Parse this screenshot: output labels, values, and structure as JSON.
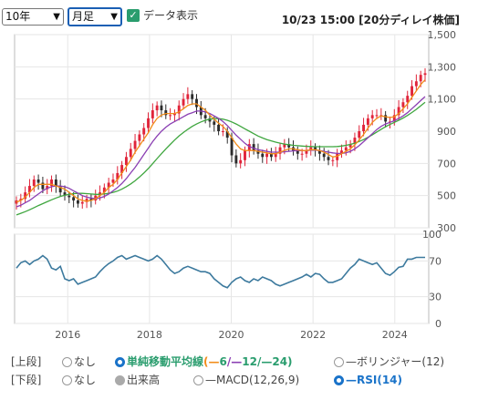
{
  "controls": {
    "period_value": "10年",
    "interval_value": "月足",
    "show_data_label": "データ表示",
    "timestamp": "10/23 15:00 [20分ディレイ株価]"
  },
  "legend": {
    "upper_label": "[上段]",
    "lower_label": "[下段]",
    "none1": "なし",
    "sma_label": "単純移動平均線",
    "sma6": "6",
    "sma12": "12",
    "sma24": "24",
    "bollinger": "ボリンジャー(12)",
    "none2": "なし",
    "volume": "出来高",
    "macd": "MACD(12,26,9)",
    "rsi": "RSI(14)"
  },
  "chart_data": [
    {
      "type": "candlestick",
      "x_ticks": [
        "2016",
        "2018",
        "2020",
        "2022",
        "2024"
      ],
      "y_ticks": [
        "300",
        "500",
        "700",
        "900",
        "1,100",
        "1,300",
        "1,500"
      ],
      "ylim": [
        300,
        1500
      ],
      "x_start_year": 2014.7,
      "x_end_year": 2024.83,
      "colors": {
        "up": "#e0243a",
        "down": "#2c2c2c",
        "sma6": "#f28c1a",
        "sma12": "#8b3fb3",
        "sma24": "#3fa63f"
      },
      "close": [
        470,
        480,
        520,
        560,
        600,
        580,
        540,
        560,
        600,
        560,
        520,
        500,
        490,
        470,
        450,
        460,
        480,
        470,
        500,
        520,
        550,
        580,
        600,
        640,
        690,
        740,
        790,
        840,
        880,
        920,
        980,
        1030,
        1060,
        1030,
        1000,
        1000,
        1010,
        1060,
        1100,
        1130,
        1100,
        1050,
        1000,
        980,
        960,
        940,
        900,
        900,
        860,
        750,
        700,
        720,
        780,
        820,
        780,
        760,
        740,
        760,
        740,
        760,
        800,
        820,
        800,
        780,
        760,
        760,
        780,
        800,
        780,
        760,
        740,
        720,
        720,
        760,
        780,
        800,
        820,
        860,
        900,
        940,
        980,
        1000,
        1000,
        1000,
        960,
        960,
        1000,
        1050,
        1080,
        1120,
        1180,
        1210,
        1250,
        1260
      ],
      "sma6": [
        460,
        470,
        490,
        520,
        550,
        570,
        570,
        570,
        570,
        560,
        550,
        540,
        520,
        500,
        480,
        470,
        465,
        470,
        480,
        500,
        520,
        550,
        570,
        600,
        640,
        680,
        720,
        770,
        810,
        850,
        890,
        940,
        980,
        1000,
        1010,
        1010,
        1010,
        1020,
        1040,
        1060,
        1070,
        1070,
        1050,
        1030,
        1000,
        975,
        950,
        930,
        900,
        860,
        820,
        790,
        780,
        780,
        780,
        775,
        770,
        765,
        760,
        760,
        770,
        780,
        790,
        790,
        785,
        780,
        780,
        785,
        785,
        780,
        770,
        755,
        740,
        745,
        760,
        775,
        790,
        815,
        845,
        880,
        920,
        955,
        980,
        995,
        990,
        985,
        990,
        1010,
        1040,
        1070,
        1110,
        1150,
        1190,
        1220
      ],
      "sma12": [
        430,
        440,
        455,
        470,
        490,
        510,
        530,
        545,
        555,
        560,
        560,
        555,
        545,
        530,
        515,
        500,
        490,
        485,
        480,
        485,
        495,
        510,
        530,
        550,
        575,
        605,
        640,
        675,
        715,
        755,
        795,
        835,
        870,
        900,
        925,
        945,
        960,
        975,
        990,
        1005,
        1015,
        1025,
        1025,
        1020,
        1010,
        995,
        980,
        960,
        935,
        905,
        875,
        850,
        825,
        805,
        795,
        785,
        780,
        775,
        770,
        770,
        770,
        772,
        775,
        778,
        780,
        780,
        780,
        782,
        782,
        780,
        775,
        770,
        765,
        762,
        762,
        765,
        775,
        790,
        810,
        835,
        860,
        885,
        910,
        930,
        945,
        955,
        965,
        980,
        995,
        1015,
        1040,
        1065,
        1090,
        1115
      ],
      "sma24": [
        380,
        390,
        400,
        412,
        425,
        438,
        450,
        462,
        474,
        485,
        495,
        502,
        508,
        512,
        514,
        514,
        512,
        510,
        508,
        508,
        510,
        514,
        520,
        528,
        540,
        555,
        572,
        592,
        615,
        640,
        668,
        698,
        730,
        760,
        790,
        818,
        845,
        870,
        892,
        912,
        930,
        945,
        958,
        968,
        975,
        978,
        978,
        975,
        968,
        958,
        945,
        930,
        915,
        900,
        885,
        870,
        858,
        848,
        840,
        832,
        826,
        820,
        816,
        812,
        810,
        808,
        806,
        805,
        804,
        804,
        804,
        804,
        804,
        805,
        808,
        812,
        818,
        826,
        836,
        848,
        862,
        878,
        895,
        912,
        928,
        942,
        955,
        968,
        982,
        998,
        1016,
        1036,
        1058,
        1080
      ]
    },
    {
      "type": "line",
      "name": "RSI(14)",
      "y_ticks": [
        "0",
        "30",
        "70",
        "100"
      ],
      "ylim": [
        0,
        100
      ],
      "values": [
        62,
        68,
        70,
        66,
        70,
        72,
        76,
        72,
        62,
        60,
        64,
        50,
        48,
        50,
        44,
        46,
        48,
        50,
        52,
        58,
        63,
        67,
        70,
        74,
        76,
        72,
        74,
        76,
        74,
        72,
        70,
        72,
        76,
        72,
        66,
        60,
        56,
        58,
        62,
        64,
        62,
        60,
        58,
        58,
        56,
        50,
        46,
        42,
        40,
        46,
        50,
        52,
        48,
        46,
        50,
        48,
        52,
        50,
        48,
        44,
        42,
        44,
        46,
        48,
        50,
        52,
        55,
        52,
        56,
        55,
        50,
        46,
        46,
        48,
        50,
        56,
        62,
        66,
        72,
        70,
        68,
        66,
        68,
        62,
        56,
        54,
        58,
        63,
        64,
        72,
        72,
        74,
        74,
        74
      ]
    }
  ]
}
